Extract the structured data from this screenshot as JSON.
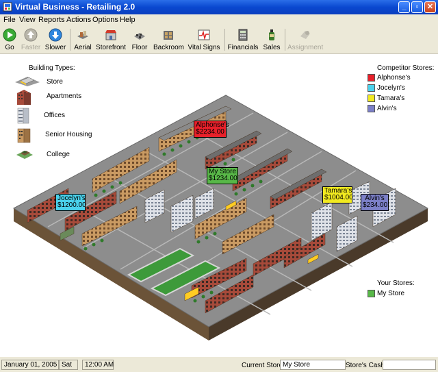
{
  "window": {
    "title": "Virtual Business - Retailing 2.0"
  },
  "menu": [
    "File",
    "View",
    "Reports",
    "Actions",
    "Options",
    "Help"
  ],
  "toolbar": {
    "go": "Go",
    "faster": "Faster",
    "slower": "Slower",
    "aerial": "Aerial",
    "storefront": "Storefront",
    "floor": "Floor",
    "backroom": "Backroom",
    "vital_signs": "Vital Signs",
    "financials": "Financials",
    "sales": "Sales",
    "assignment": "Assignment"
  },
  "building_types": {
    "title": "Building Types:",
    "items": [
      "Store",
      "Apartments",
      "Offices",
      "Senior Housing",
      "College"
    ]
  },
  "competitor_stores": {
    "title": "Competitor Stores:",
    "items": [
      {
        "name": "Alphonse's",
        "color": "#e8202a"
      },
      {
        "name": "Jocelyn's",
        "color": "#4ad2ec"
      },
      {
        "name": "Tamara's",
        "color": "#f2ea20"
      },
      {
        "name": "Alvin's",
        "color": "#7c80c8"
      }
    ]
  },
  "your_stores": {
    "title": "Your Stores:",
    "items": [
      {
        "name": "My Store",
        "color": "#58b848"
      }
    ]
  },
  "map_tags": {
    "alphonse": {
      "name": "Alphonse's",
      "value": "$2234.00"
    },
    "mystore": {
      "name": "My Store",
      "value": "$1234.00"
    },
    "jocelyn": {
      "name": "Jocelyn's",
      "value": "$1200.00"
    },
    "tamara": {
      "name": "Tamara's",
      "value": "$1004.00"
    },
    "alvin": {
      "name": "Alvin's",
      "value": "$234.00"
    }
  },
  "status": {
    "date": "January 01, 2005",
    "day": "Sat",
    "time": "12:00 AM",
    "current_store_label": "Current Store:",
    "current_store_value": "My Store",
    "cash_label": "Store's Cash:",
    "cash_value": ""
  }
}
